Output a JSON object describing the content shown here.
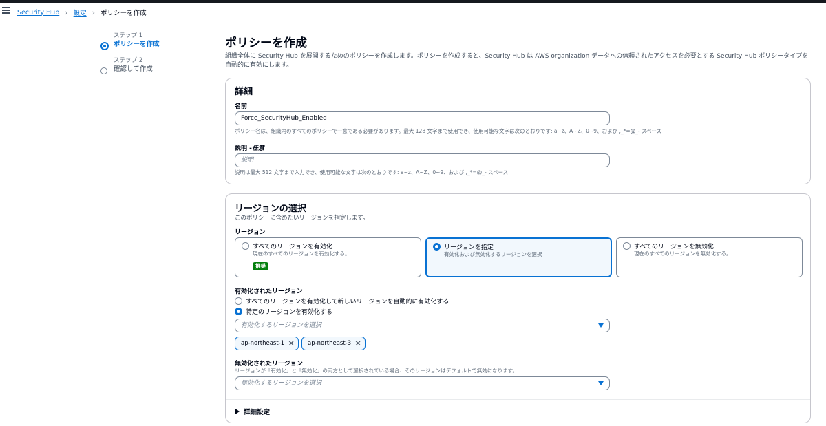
{
  "breadcrumb": {
    "items": [
      "Security Hub",
      "設定",
      "ポリシーを作成"
    ]
  },
  "steps": [
    {
      "label": "ステップ 1",
      "title": "ポリシーを作成"
    },
    {
      "label": "ステップ 2",
      "title": "確認して作成"
    }
  ],
  "page": {
    "title": "ポリシーを作成",
    "description": "組織全体に Security Hub を展開するためのポリシーを作成します。ポリシーを作成すると、Security Hub は AWS organization データへの信頼されたアクセスを必要とする Security Hub ポリシータイプを自動的に有効にします。"
  },
  "details": {
    "heading": "詳細",
    "name_label": "名前",
    "name_value": "Force_SecurityHub_Enabled",
    "name_hint": "ポリシー名は、組織内のすべてのポリシーで一意である必要があります。最大 128 文字まで使用でき、使用可能な文字は次のとおりです: a~z、A~Z、0~9、および ,_*=@_- スペース",
    "desc_label": "説明 -",
    "desc_label_optional": "任意",
    "desc_placeholder": "説明",
    "desc_hint": "説明は最大 512 文字まで入力でき、使用可能な文字は次のとおりです: a~z、A~Z、0~9、および ,_*=@_- スペース"
  },
  "region": {
    "heading": "リージョンの選択",
    "subheading": "このポリシーに含めたいリージョンを指定します。",
    "label": "リージョン",
    "tiles": [
      {
        "title": "すべてのリージョンを有効化",
        "desc": "現在のすべてのリージョンを有効化する。",
        "badge": "推奨",
        "selected": false
      },
      {
        "title": "リージョンを指定",
        "desc": "有効化および無効化するリージョンを選択",
        "selected": true
      },
      {
        "title": "すべてのリージョンを無効化",
        "desc": "現在のすべてのリージョンを無効化する。",
        "selected": false
      }
    ],
    "enabled_label": "有効化されたリージョン",
    "enabled_options": [
      {
        "label": "すべてのリージョンを有効化して新しいリージョンを自動的に有効化する",
        "selected": false
      },
      {
        "label": "特定のリージョンを有効化する",
        "selected": true
      }
    ],
    "enabled_placeholder": "有効化するリージョンを選択",
    "enabled_tokens": [
      "ap-northeast-1",
      "ap-northeast-3"
    ],
    "disabled_label": "無効化されたリージョン",
    "disabled_hint": "リージョンが「有効化」と「無効化」の両方として選択されている場合、そのリージョンはデフォルトで無効になります。",
    "disabled_placeholder": "無効化するリージョンを選択",
    "advanced_label": "詳細設定"
  },
  "colors": {
    "accent": "#0972d3",
    "badge": "#037f0c"
  }
}
